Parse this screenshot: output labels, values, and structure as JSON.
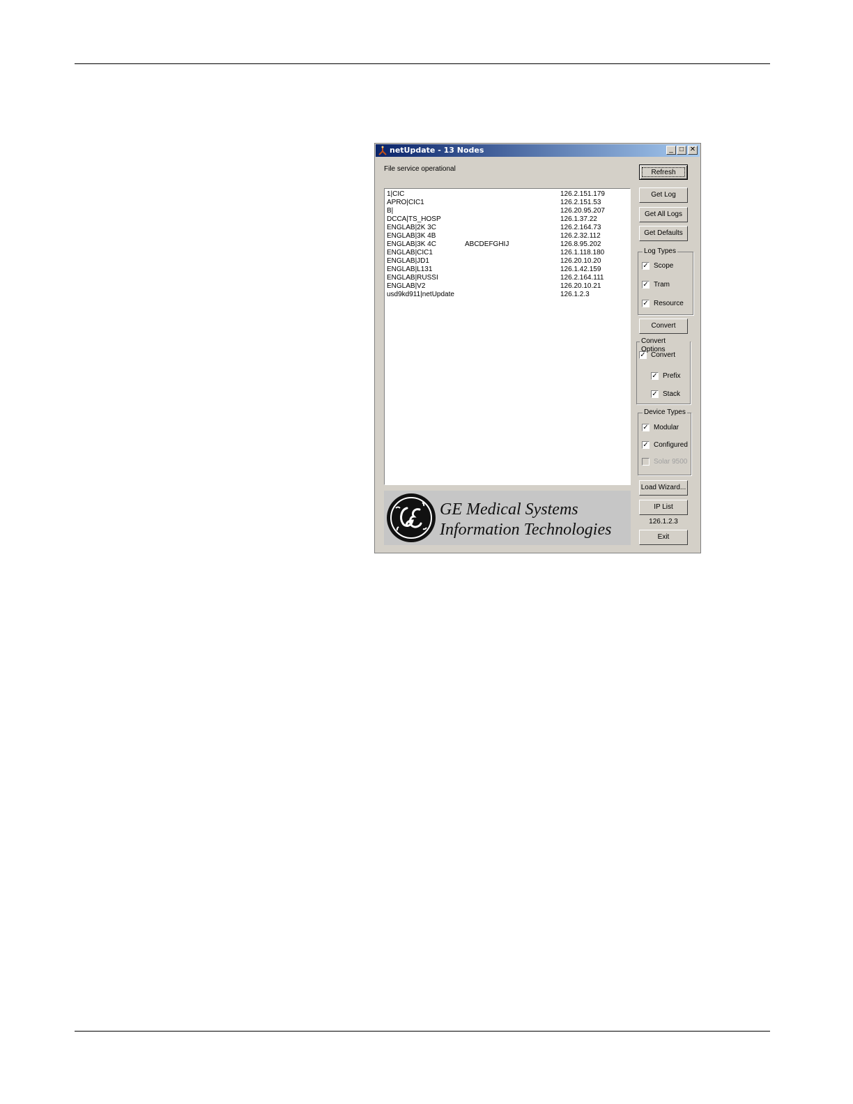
{
  "window": {
    "title": "netUpdate - 13 Nodes",
    "controls": {
      "minimize": "_",
      "maximize": "□",
      "close": "✕"
    }
  },
  "status_text": "File service operational",
  "nodes": [
    {
      "name": "1|CIC",
      "extra": "",
      "ip": "126.2.151.179"
    },
    {
      "name": "APRO|CIC1",
      "extra": "",
      "ip": "126.2.151.53"
    },
    {
      "name": "B|",
      "extra": "",
      "ip": "126.20.95.207"
    },
    {
      "name": "DCCA|TS_HOSP",
      "extra": "",
      "ip": "126.1.37.22"
    },
    {
      "name": "ENGLAB|2K 3C",
      "extra": "",
      "ip": "126.2.164.73"
    },
    {
      "name": "ENGLAB|3K 4B",
      "extra": "",
      "ip": "126.2.32.112"
    },
    {
      "name": "ENGLAB|3K 4C",
      "extra": "ABCDEFGHIJ",
      "ip": "126.8.95.202"
    },
    {
      "name": "ENGLAB|CIC1",
      "extra": "",
      "ip": "126.1.118.180"
    },
    {
      "name": "ENGLAB|JD1",
      "extra": "",
      "ip": "126.20.10.20"
    },
    {
      "name": "ENGLAB|L131",
      "extra": "",
      "ip": "126.1.42.159"
    },
    {
      "name": "ENGLAB|RUSSI",
      "extra": "",
      "ip": "126.2.164.111"
    },
    {
      "name": "ENGLAB|V2",
      "extra": "",
      "ip": "126.20.10.21"
    },
    {
      "name": "usd9kd911|netUpdate",
      "extra": "",
      "ip": "126.1.2.3"
    }
  ],
  "buttons": {
    "refresh": "Refresh",
    "get_log": "Get Log",
    "get_all_logs": "Get All Logs",
    "get_defaults": "Get Defaults",
    "convert": "Convert",
    "load_wizard": "Load Wizard...",
    "ip_list": "IP List",
    "exit": "Exit"
  },
  "log_types": {
    "label": "Log Types",
    "scope": {
      "label": "Scope",
      "checked": true
    },
    "tram": {
      "label": "Tram",
      "checked": true
    },
    "resource": {
      "label": "Resource",
      "checked": true
    }
  },
  "convert_options": {
    "label": "Convert Options",
    "convert": {
      "label": "Convert",
      "checked": true
    },
    "prefix": {
      "label": "Prefix",
      "checked": true
    },
    "stack": {
      "label": "Stack",
      "checked": true
    }
  },
  "device_types": {
    "label": "Device Types",
    "modular": {
      "label": "Modular",
      "checked": true
    },
    "configured": {
      "label": "Configured",
      "checked": true
    },
    "solar": {
      "label": "Solar 9500",
      "checked": false,
      "disabled": true
    }
  },
  "local_ip": "126.1.2.3",
  "logo": {
    "line1": "GE Medical Systems",
    "line2": "Information Technologies"
  },
  "check_glyph": "✓"
}
